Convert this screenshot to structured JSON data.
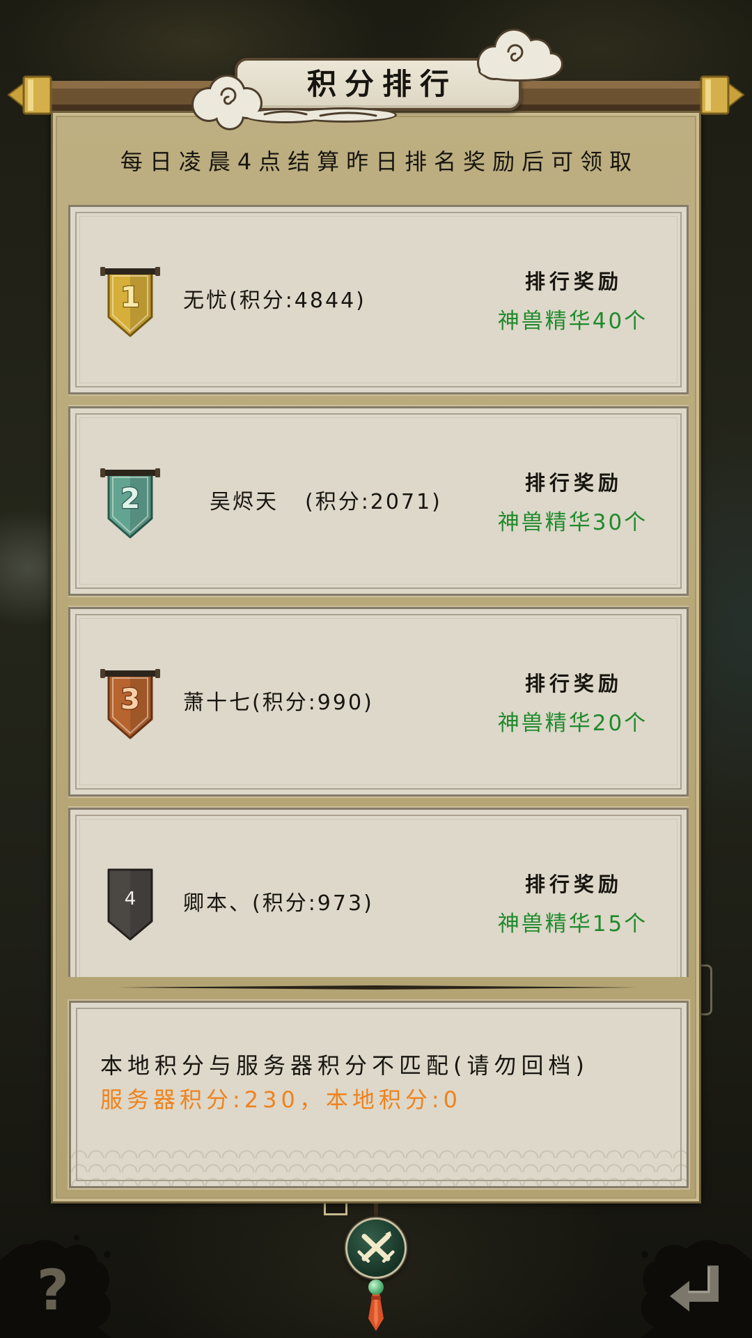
{
  "window": {
    "title": "积分排行",
    "subtitle": "每日凌晨4点结算昨日排名奖励后可领取"
  },
  "rankings": [
    {
      "rank": "1",
      "name": "无忧",
      "score": "(积分:4844)",
      "reward_title": "排行奖励",
      "reward": "神兽精华40个",
      "badge_icon": "gold-rank-banner-icon"
    },
    {
      "rank": "2",
      "name": "吴烬天",
      "score": "(积分:2071)",
      "reward_title": "排行奖励",
      "reward": "神兽精华30个",
      "badge_icon": "jade-rank-banner-icon"
    },
    {
      "rank": "3",
      "name": "萧十七",
      "score": "(积分:990)",
      "reward_title": "排行奖励",
      "reward": "神兽精华20个",
      "badge_icon": "bronze-rank-banner-icon"
    },
    {
      "rank": "4",
      "name": "卿本、",
      "score": "(积分:973)",
      "reward_title": "排行奖励",
      "reward": "神兽精华15个",
      "badge_icon": "plain-rank-banner-icon"
    }
  ],
  "notice": {
    "mismatch": "本地积分与服务器积分不匹配(请勿回档)",
    "scores": "服务器积分:230，本地积分:0"
  },
  "buttons": {
    "close": {
      "icon": "crossed-swords-icon"
    },
    "help": {
      "icon": "help-icon",
      "glyph": "?"
    },
    "back": {
      "icon": "return-arrow-icon"
    }
  },
  "colors": {
    "reward_green": "#1f8a2b",
    "notice_orange": "#f0821c",
    "panel": "#b8a878",
    "card": "#ddd8ca",
    "badge_gold": "#d6ae3a",
    "badge_jade": "#62a391",
    "badge_bronze": "#b8642f",
    "badge_plain": "#4b4743"
  }
}
